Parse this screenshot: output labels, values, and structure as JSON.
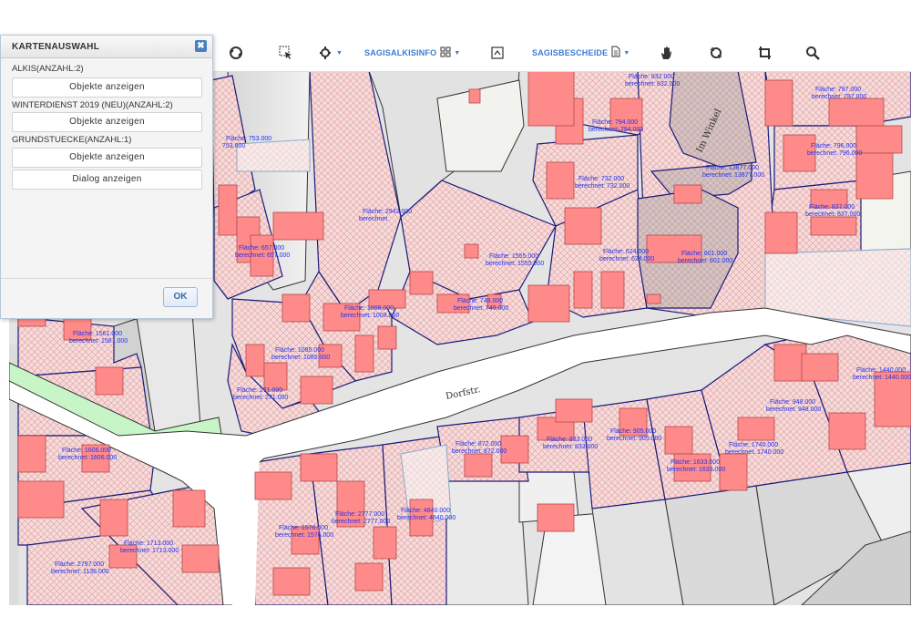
{
  "panel": {
    "title": "KARTENAUSWAHL",
    "close_icon": "close-icon",
    "sections": [
      {
        "label": "ALKIS(ANZAHL:2)",
        "buttons": [
          "Objekte anzeigen"
        ]
      },
      {
        "label": "WINTERDIENST 2019 (NEU)(ANZAHL:2)",
        "buttons": [
          "Objekte anzeigen"
        ]
      },
      {
        "label": "GRUNDSTUECKE(ANZAHL:1)",
        "buttons": [
          "Objekte anzeigen",
          "Dialog anzeigen"
        ]
      }
    ],
    "ok_label": "OK"
  },
  "toolbar": {
    "icons": [
      "refresh-icon",
      "select-cursor-icon",
      "measure-tool-icon",
      "grid-icon",
      "document-icon",
      "map-export-icon",
      "document-icon",
      "pan-hand-icon",
      "rotate-icon",
      "zoom-crop-icon",
      "zoom-search-icon"
    ],
    "sagisalkisinfo_label": "SAGISALKISINFO",
    "sagisbescheide_label": "SAGISBESCHEIDE"
  },
  "map": {
    "streets": [
      "Dorfstr.",
      "Im Winkel"
    ],
    "parcel_labels": [
      {
        "area": "Fläche: 753.000",
        "computed": "753.000"
      },
      {
        "area": "Fläche: 657.000",
        "computed": "berechnet: 657.000"
      },
      {
        "area": "Fläche: 2942.000",
        "computed": "berechnet"
      },
      {
        "area": "Fläche: 1555.000",
        "computed": "berechnet: 1555.000"
      },
      {
        "area": "Fläche: 749.000",
        "computed": "berechnet: 749.000"
      },
      {
        "area": "Fläche: 1008.000",
        "computed": "berechnet: 1008.000"
      },
      {
        "area": "Fläche: 1085.000",
        "computed": "berechnet: 1085.000"
      },
      {
        "area": "Fläche: 271.000",
        "computed": "berechnet: 271.000"
      },
      {
        "area": "Fläche: 1561.000",
        "computed": "berechnet: 1561.000"
      },
      {
        "area": "Fläche: 1606.000",
        "computed": "berechnet: 1606.000"
      },
      {
        "area": "Fläche: 1713.000",
        "computed": "berechnet: 1713.000"
      },
      {
        "area": "Fläche: 2797.000",
        "computed": "berechnet: 1136.000"
      },
      {
        "area": "Fläche: 1576.000",
        "computed": "berechnet: 1576.000"
      },
      {
        "area": "Fläche: 2777.000",
        "computed": "berechnet: 2777.000"
      },
      {
        "area": "Fläche: 4840.000",
        "computed": "berechnet: 4840.000"
      },
      {
        "area": "Fläche: 872.000",
        "computed": "berechnet: 872.000"
      },
      {
        "area": "Fläche: 833.000",
        "computed": "berechnet: 833.000"
      },
      {
        "area": "Fläche: 905.000",
        "computed": "berechnet: 905.000"
      },
      {
        "area": "Fläche: 1633.000",
        "computed": "berechnet: 1633.000"
      },
      {
        "area": "Fläche: 1740.000",
        "computed": "berechnet: 1740.000"
      },
      {
        "area": "Fläche: 948.000",
        "computed": "berechnet: 948.000"
      },
      {
        "area": "Fläche: 1440.000",
        "computed": "berechnet: 1440.000"
      },
      {
        "area": "Fläche: 624.000",
        "computed": "berechnet: 624.000"
      },
      {
        "area": "Fläche: 601.000",
        "computed": "berechnet: 601.000"
      },
      {
        "area": "Fläche: 732.000",
        "computed": "berechnet: 732.000"
      },
      {
        "area": "Fläche: 794.000",
        "computed": "berechnet: 794.000"
      },
      {
        "area": "Fläche: 832.000",
        "computed": "berechnet: 832.000"
      },
      {
        "area": "Fläche: 13877.000",
        "computed": "berechnet: 13877.000"
      },
      {
        "area": "Fläche: 787.000",
        "computed": "berechnet: 787.000"
      },
      {
        "area": "Fläche: 796.000",
        "computed": "berechnet: 796.000"
      },
      {
        "area": "Fläche: 837.000",
        "computed": "berechnet: 837.000"
      }
    ],
    "colors": {
      "parcel_fill": "#f2d4d4",
      "building_fill": "#ff8a8a",
      "parcel_border": "#1a1a7a",
      "street": "#ffffff",
      "neutral_parcel": "#dcdcdc",
      "green_area": "#c8f5c8",
      "label_text": "#2233ee"
    }
  }
}
